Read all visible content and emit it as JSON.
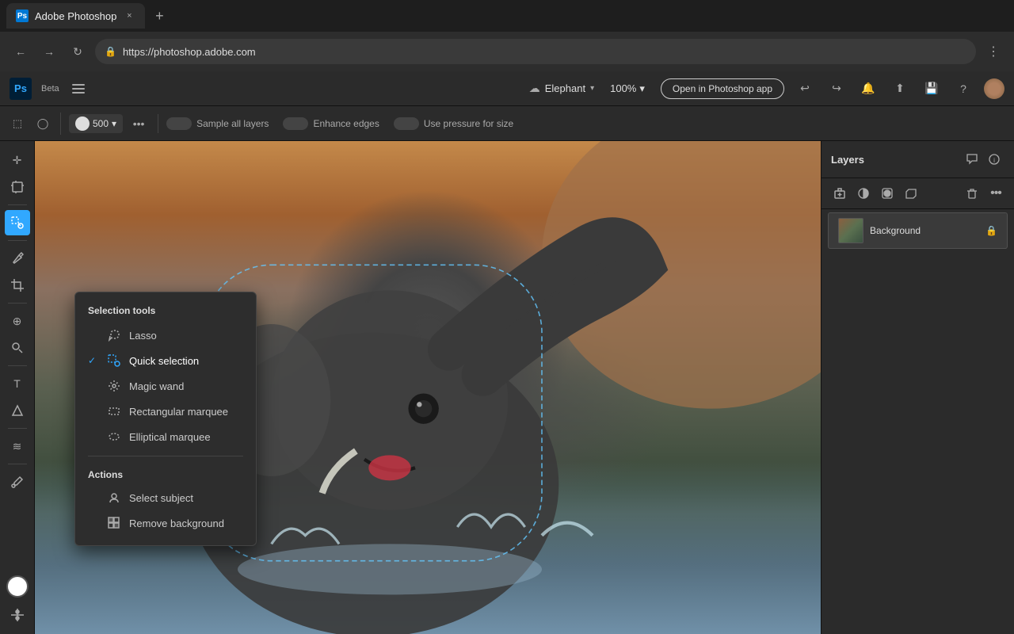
{
  "browser": {
    "tab": {
      "favicon_text": "Ps",
      "title": "Adobe Photoshop",
      "close_label": "×"
    },
    "new_tab_label": "+",
    "nav": {
      "back_label": "←",
      "forward_label": "→",
      "reload_label": "↻",
      "address": "https://photoshop.adobe.com",
      "lock_icon": "🔒",
      "menu_label": "⋮"
    }
  },
  "app": {
    "logo_text": "Ps",
    "beta_label": "Beta",
    "hamburger_label": "☰",
    "header": {
      "cloud_icon": "☁",
      "filename": "Elephant",
      "chevron": "▾",
      "zoom": "100%",
      "zoom_chevron": "▾",
      "open_photoshop_btn": "Open in Photoshop app",
      "undo_icon": "↩",
      "redo_icon": "↪",
      "bell_icon": "🔔",
      "share_icon": "⬆",
      "save_icon": "💾",
      "help_icon": "?",
      "avatar_initials": ""
    },
    "toolbar": {
      "marquee_rect_icon": "⬚",
      "marquee_ellip_icon": "◯",
      "brush_size": "500",
      "brush_chevron": "▾",
      "more_icon": "•••",
      "sample_all_layers_label": "Sample all layers",
      "enhance_edges_label": "Enhance edges",
      "use_pressure_label": "Use pressure for size"
    },
    "tools": {
      "move_icon": "✛",
      "artboard_icon": "⬜",
      "selection_icon": "⊡",
      "pen_icon": "✒",
      "crop_icon": "⤡",
      "heal_icon": "⊕",
      "clone_icon": "⊗",
      "text_icon": "T",
      "shape_icon": "◑",
      "liquefy_icon": "≋",
      "eyedropper_icon": "✦",
      "adjust_icon": "⊞"
    },
    "selection_popup": {
      "section_title": "Selection tools",
      "tools": [
        {
          "id": "lasso",
          "label": "Lasso",
          "active": false,
          "icon": "lasso"
        },
        {
          "id": "quick-selection",
          "label": "Quick selection",
          "active": true,
          "icon": "quick-sel"
        },
        {
          "id": "magic-wand",
          "label": "Magic wand",
          "active": false,
          "icon": "magic-wand"
        },
        {
          "id": "rectangular-marquee",
          "label": "Rectangular marquee",
          "active": false,
          "icon": "rect-marquee"
        },
        {
          "id": "elliptical-marquee",
          "label": "Elliptical marquee",
          "active": false,
          "icon": "ellip-marquee"
        }
      ],
      "actions_title": "Actions",
      "actions": [
        {
          "id": "select-subject",
          "label": "Select subject",
          "icon": "select-subj"
        },
        {
          "id": "remove-background",
          "label": "Remove background",
          "icon": "remove-bg"
        }
      ]
    },
    "layers_panel": {
      "title": "Layers",
      "layer": {
        "name": "Background",
        "lock_icon": "🔒"
      },
      "toolbar_icons": {
        "add": "+",
        "adjustment": "◑",
        "mask": "⬜",
        "group": "⊞",
        "delete": "🗑",
        "more": "•••"
      },
      "panel_tab_icons": {
        "chat": "💬",
        "info": "ⓘ"
      }
    }
  }
}
